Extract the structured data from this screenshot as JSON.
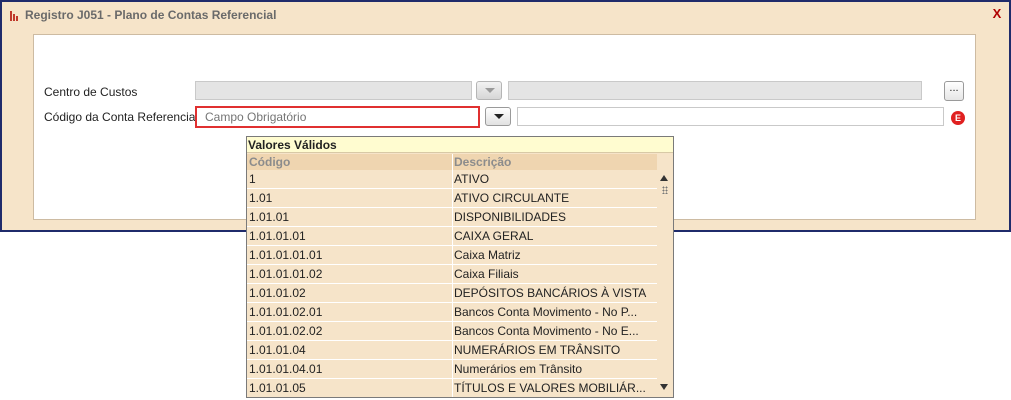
{
  "window": {
    "title": "Registro J051 - Plano de Contas Referencial",
    "close_label": "X"
  },
  "form": {
    "centro_label": "Centro de Custos",
    "codigo_label": "Código da Conta Referencial",
    "codigo_placeholder": "Campo Obrigatório",
    "ellipsis_label": "...",
    "error_glyph": "E"
  },
  "popup": {
    "title": "Valores Válidos",
    "col_code": "Código",
    "col_desc": "Descrição",
    "rows": [
      {
        "code": "1",
        "desc": "ATIVO"
      },
      {
        "code": "1.01",
        "desc": "ATIVO CIRCULANTE"
      },
      {
        "code": "1.01.01",
        "desc": "DISPONIBILIDADES"
      },
      {
        "code": "1.01.01.01",
        "desc": "CAIXA GERAL"
      },
      {
        "code": "1.01.01.01.01",
        "desc": "Caixa Matriz"
      },
      {
        "code": "1.01.01.01.02",
        "desc": "Caixa Filiais"
      },
      {
        "code": "1.01.01.02",
        "desc": "DEPÓSITOS BANCÁRIOS À VISTA"
      },
      {
        "code": "1.01.01.02.01",
        "desc": "Bancos Conta Movimento - No P..."
      },
      {
        "code": "1.01.01.02.02",
        "desc": "Bancos Conta Movimento - No E..."
      },
      {
        "code": "1.01.01.04",
        "desc": "NUMERÁRIOS EM TRÂNSITO"
      },
      {
        "code": "1.01.01.04.01",
        "desc": "Numerários em Trânsito"
      },
      {
        "code": "1.01.01.05",
        "desc": "TÍTULOS E VALORES MOBILIÁR..."
      }
    ]
  },
  "colors": {
    "window_border": "#1f2b6b",
    "window_bg": "#f6e4c9",
    "required_border": "#e03030",
    "error_icon": "#e02020"
  }
}
